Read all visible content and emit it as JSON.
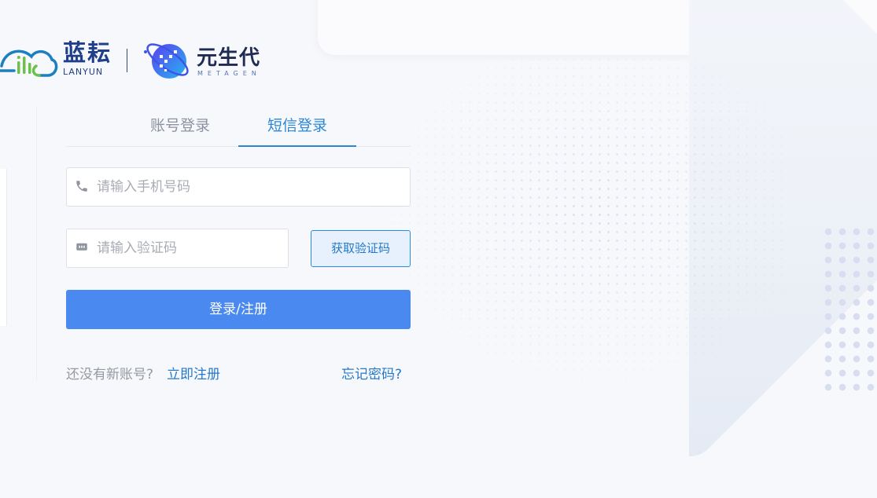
{
  "brand": {
    "lanyun_cn": "蓝耘",
    "lanyun_en": "LANYUN",
    "metagen_cn": "元生代",
    "metagen_en": "METAGEN"
  },
  "tabs": [
    {
      "label": "账号登录",
      "active": false
    },
    {
      "label": "短信登录",
      "active": true
    }
  ],
  "phone": {
    "placeholder": "请输入手机号码",
    "value": ""
  },
  "code": {
    "placeholder": "请输入验证码",
    "value": ""
  },
  "get_code_label": "获取验证码",
  "submit_label": "登录/注册",
  "footer": {
    "no_account": "还没有新账号?",
    "register": "立即注册",
    "forgot": "忘记密码?"
  },
  "colors": {
    "primary": "#4a89ef",
    "link": "#2679c9",
    "tab_active": "#2b86d6",
    "brand_navy": "#1f3f8c"
  },
  "icons": {
    "phone": "phone-icon",
    "code": "message-code-icon"
  }
}
